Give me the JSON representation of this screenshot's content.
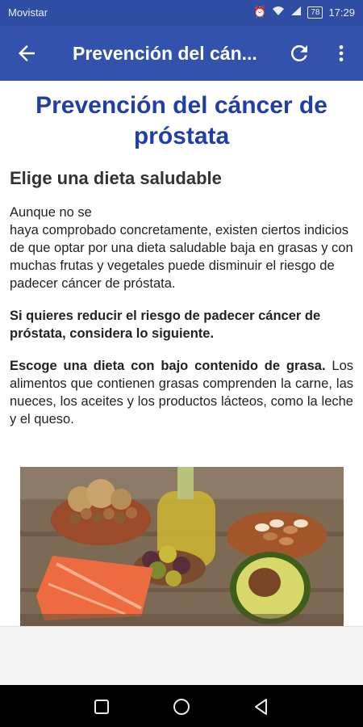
{
  "status": {
    "carrier": "Movistar",
    "battery": "78",
    "time": "17:29"
  },
  "appbar": {
    "title": "Prevención del cán...",
    "back_icon": "arrow-back-icon",
    "refresh_icon": "refresh-icon",
    "more_icon": "more-vert-icon"
  },
  "article": {
    "title": "Prevención del cáncer de próstata",
    "section_title": "Elige una dieta saludable",
    "intro_line1": "Aunque no se",
    "intro_rest": "haya comprobado concretamente, existen ciertos indicios de que optar por una dieta saludable baja en grasas y con muchas frutas y vegetales puede disminuir el riesgo de padecer cáncer de próstata.",
    "highlight": "Si quieres reducir el riesgo de padecer cáncer de próstata, considera lo siguiente.",
    "tip_bold": "Escoge una dieta con bajo contenido de grasa.",
    "tip_text": " Los alimentos que contienen grasas comprenden la carne, las nueces, los aceites y los productos lácteos, como la leche y el queso."
  },
  "colors": {
    "statusbar": "#2f4ea3",
    "appbar": "#3352ad",
    "title": "#1f3ea6"
  },
  "navbar": {
    "icons": [
      "recent-apps-icon",
      "home-icon",
      "back-triangle-icon"
    ]
  }
}
